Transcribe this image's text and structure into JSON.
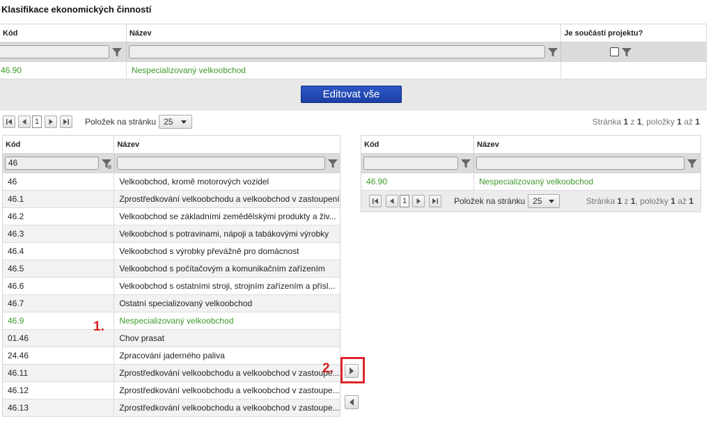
{
  "title": "Klasifikace ekonomických činností",
  "top_grid": {
    "headers": [
      "Kód",
      "Název",
      "Je součástí projektu?"
    ],
    "row": {
      "kod": "46.90",
      "nazev": "Nespecializovaný velkoobchod"
    }
  },
  "edit_button": "Editovat vše",
  "pager": {
    "page": "1",
    "per_page_label": "Položek na stránku",
    "per_page_value": "25",
    "info_stranka": "Stránka",
    "info_z": "z",
    "info_polozky": ", položky",
    "info_az": "až",
    "page_num": "1",
    "page_total": "1",
    "items_from": "1",
    "items_to": "1"
  },
  "left_grid": {
    "headers": [
      "Kód",
      "Název"
    ],
    "filter_kod": "46",
    "rows": [
      {
        "kod": "46",
        "nazev": "Velkoobchod, kromě motorových vozidel"
      },
      {
        "kod": "46.1",
        "nazev": "Zprostředkování velkoobchodu a velkoobchod v zastoupení"
      },
      {
        "kod": "46.2",
        "nazev": "Velkoobchod se základními zemědělskými produkty a živ..."
      },
      {
        "kod": "46.3",
        "nazev": "Velkoobchod s potravinami, nápoji a tabákovými výrobky"
      },
      {
        "kod": "46.4",
        "nazev": "Velkoobchod s výrobky převážně pro domácnost"
      },
      {
        "kod": "46.5",
        "nazev": "Velkoobchod s počítačovým a komunikačním zařízením"
      },
      {
        "kod": "46.6",
        "nazev": "Velkoobchod s ostatními stroji, strojním zařízením a přísl..."
      },
      {
        "kod": "46.7",
        "nazev": "Ostatní specializovaný velkoobchod"
      },
      {
        "kod": "46.9",
        "nazev": "Nespecializovaný velkoobchod"
      },
      {
        "kod": "01.46",
        "nazev": "Chov prasat"
      },
      {
        "kod": "24.46",
        "nazev": "Zpracování jaderného paliva"
      },
      {
        "kod": "46.11",
        "nazev": "Zprostředkování velkoobchodu a velkoobchod v zastoupe..."
      },
      {
        "kod": "46.12",
        "nazev": "Zprostředkování velkoobchodu a velkoobchod v zastoupe..."
      },
      {
        "kod": "46.13",
        "nazev": "Zprostředkování velkoobchodu a velkoobchod v zastoupe..."
      }
    ]
  },
  "right_grid": {
    "headers": [
      "Kód",
      "Název"
    ],
    "row": {
      "kod": "46.90",
      "nazev": "Nespecializovaný velkoobchod"
    }
  },
  "markers": {
    "one": "1.",
    "two": "2."
  },
  "colors": {
    "selected_text": "#3d9a2a",
    "button_blue": "#1c3fa6",
    "annotation_red": "#e0242a"
  }
}
